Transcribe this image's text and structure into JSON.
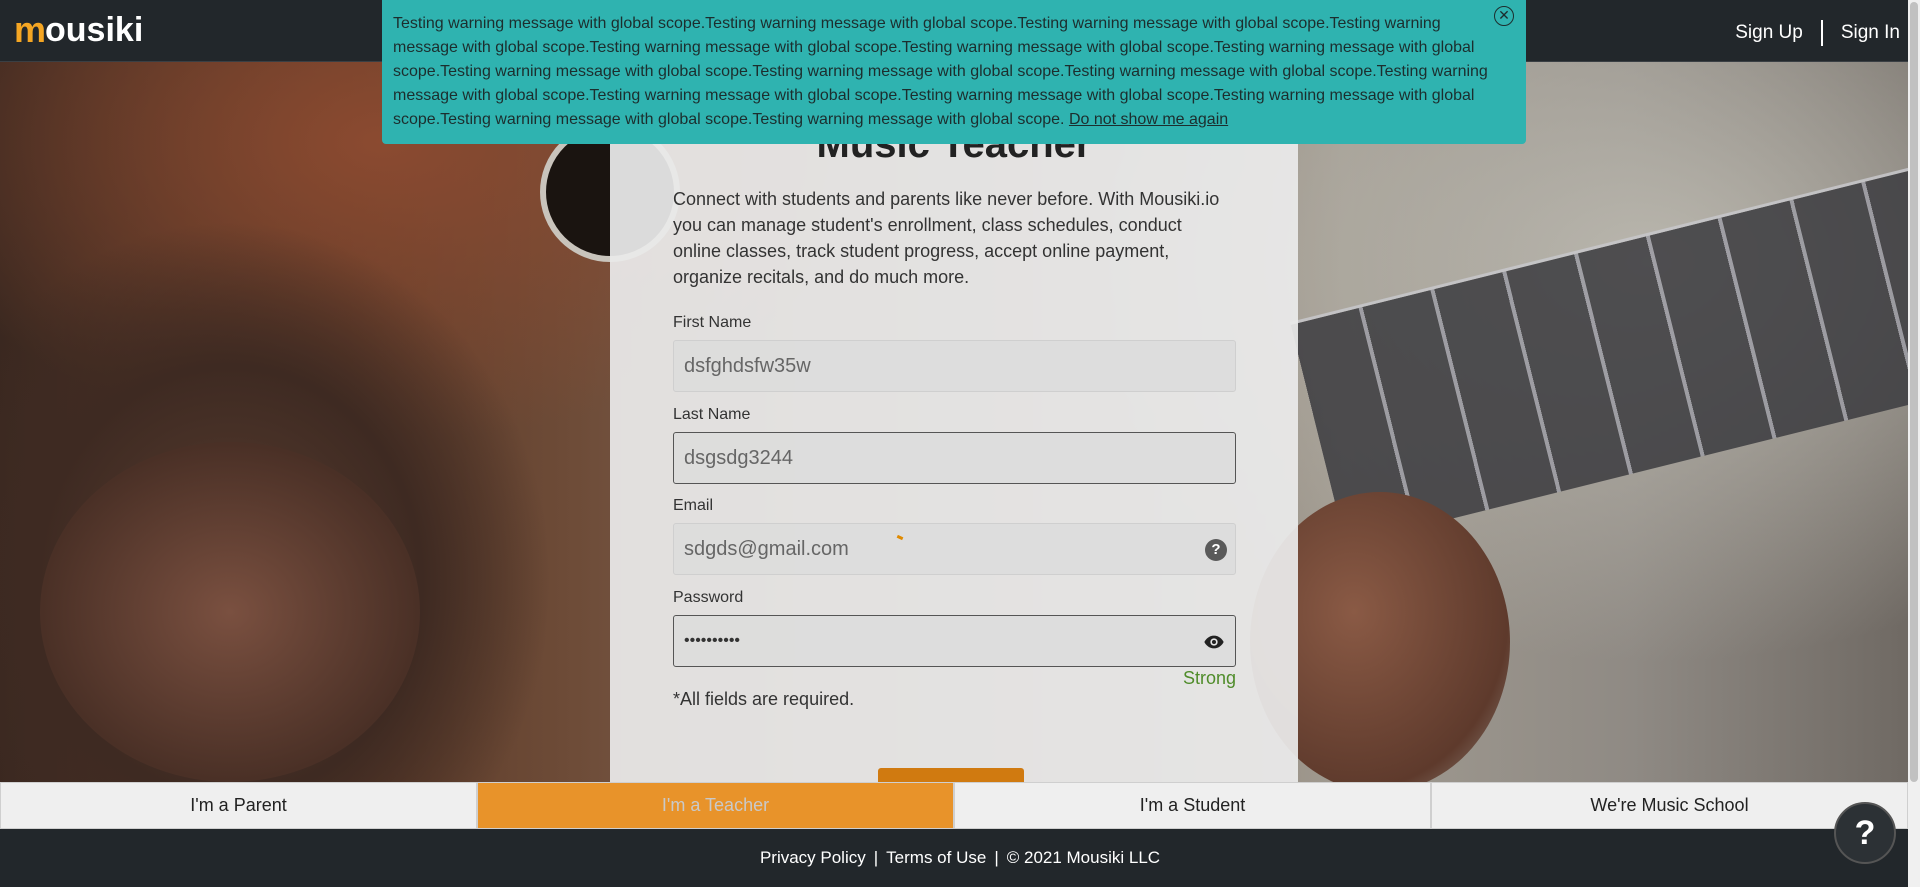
{
  "header": {
    "logo_first": "m",
    "logo_rest": "ousiki",
    "sign_up": "Sign Up",
    "sign_in": "Sign In"
  },
  "banner": {
    "message": "Testing warning message with global scope.Testing warning message with global scope.Testing warning message with global scope.Testing warning message with global scope.Testing warning message with global scope.Testing warning message with global scope.Testing warning message with global scope.Testing warning message with global scope.Testing warning message with global scope.Testing warning message with global scope.Testing warning message with global scope.Testing warning message with global scope.Testing warning message with global scope.Testing warning message with global scope.Testing warning message with global scope.Testing warning message with global scope.",
    "dismiss_link": "Do not show me again",
    "close_icon": "close-circle-icon"
  },
  "card": {
    "title": "Music Teacher",
    "description": "Connect with students and parents like never before. With Mousiki.io you can manage student's enrollment, class schedules, conduct online classes, track student progress, accept online payment, organize recitals, and do much more.",
    "first_name_label": "First Name",
    "first_name_value": "dsfghdsfw35w",
    "last_name_label": "Last Name",
    "last_name_value": "dsgsdg3244",
    "email_label": "Email",
    "email_value": "sdgds@gmail.com",
    "password_label": "Password",
    "password_value": "••••••••••",
    "strength": "Strong",
    "required_note": "*All fields are required."
  },
  "tabs": [
    {
      "label": "I'm a Parent",
      "active": false
    },
    {
      "label": "I'm a Teacher",
      "active": true
    },
    {
      "label": "I'm a Student",
      "active": false
    },
    {
      "label": "We're Music School",
      "active": false
    }
  ],
  "footer": {
    "privacy": "Privacy Policy",
    "terms": "Terms of Use",
    "copyright": "© 2021 Mousiki LLC",
    "separator": "|"
  },
  "help_fab": "?",
  "colors": {
    "accent": "#e8932a",
    "banner": "#2fb3b0",
    "header": "#22272b",
    "strength": "#4f8c2a"
  }
}
